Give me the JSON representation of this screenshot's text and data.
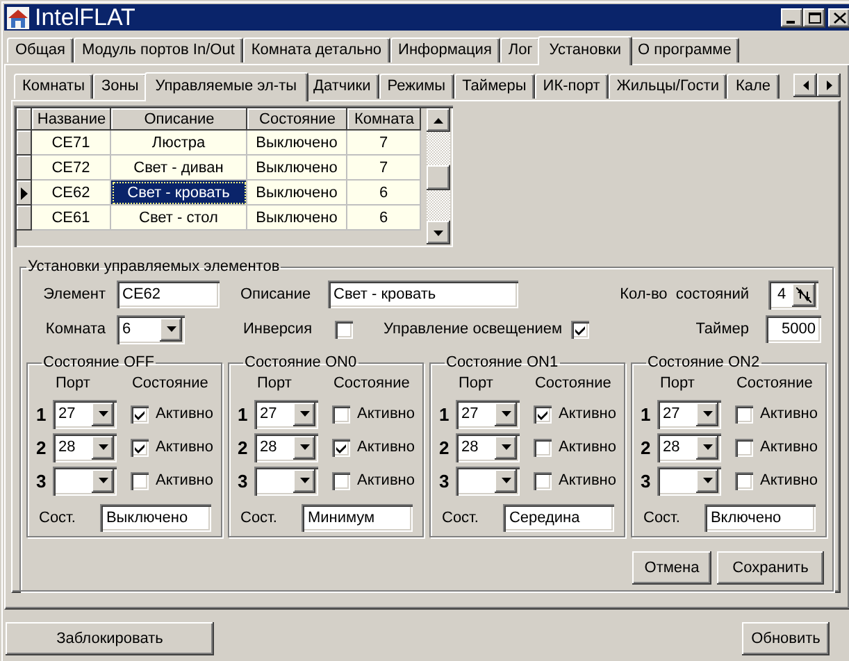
{
  "window": {
    "title": "IntelFLAT"
  },
  "tabs": [
    {
      "label": "Общая",
      "selected": false
    },
    {
      "label": "Модуль портов In/Out",
      "selected": false
    },
    {
      "label": "Комната детально",
      "selected": false
    },
    {
      "label": "Информация",
      "selected": false
    },
    {
      "label": "Лог",
      "selected": false
    },
    {
      "label": "Установки",
      "selected": true
    },
    {
      "label": "О программе",
      "selected": false
    }
  ],
  "sub_tabs": [
    {
      "label": "Комнаты",
      "selected": false
    },
    {
      "label": "Зоны",
      "selected": false
    },
    {
      "label": "Управляемые эл-ты",
      "selected": true
    },
    {
      "label": "Датчики",
      "selected": false
    },
    {
      "label": "Режимы",
      "selected": false
    },
    {
      "label": "Таймеры",
      "selected": false
    },
    {
      "label": "ИК-порт",
      "selected": false
    },
    {
      "label": "Жильцы/Гости",
      "selected": false
    },
    {
      "label": "Кале",
      "selected": false
    }
  ],
  "table": {
    "columns": [
      "Название",
      "Описание",
      "Состояние",
      "Комната"
    ],
    "rows": [
      {
        "cells": [
          "CE71",
          "Люстра",
          "Выключено",
          "7"
        ],
        "selected": false
      },
      {
        "cells": [
          "CE72",
          "Свет - диван",
          "Выключено",
          "7"
        ],
        "selected": false
      },
      {
        "cells": [
          "CE62",
          "Свет - кровать",
          "Выключено",
          "6"
        ],
        "selected": true
      },
      {
        "cells": [
          "CE61",
          "Свет - стол",
          "Выключено",
          "6"
        ],
        "selected": false
      }
    ]
  },
  "settings": {
    "title": "Установки управляемых элементов",
    "element": {
      "label": "Элемент",
      "value": "CE62"
    },
    "description": {
      "label": "Описание",
      "value": "Свет - кровать"
    },
    "state_count": {
      "label": "Кол-во  состояний",
      "value": "4"
    },
    "room": {
      "label": "Комната",
      "value": "6"
    },
    "inversion": {
      "label": "Инверсия",
      "checked": false
    },
    "lighting_control": {
      "label": "Управление освещением",
      "checked": true
    },
    "timer": {
      "label": "Таймер",
      "value": "5000"
    },
    "states": [
      {
        "title": "Состояние OFF",
        "port_header": "Порт",
        "state_header": "Состояние",
        "ports": [
          {
            "number": "1",
            "value": "27",
            "label": "Активно",
            "checked": true
          },
          {
            "number": "2",
            "value": "28",
            "label": "Активно",
            "checked": true
          },
          {
            "number": "3",
            "label": "Активно",
            "checked": false
          }
        ],
        "state_label": "Сост.",
        "state_value": "Выключено"
      },
      {
        "title": "Состояние ON0",
        "port_header": "Порт",
        "state_header": "Состояние",
        "ports": [
          {
            "number": "1",
            "value": "27",
            "label": "Активно",
            "checked": false
          },
          {
            "number": "2",
            "value": "28",
            "label": "Активно",
            "checked": true
          },
          {
            "number": "3",
            "label": "Активно",
            "checked": false
          }
        ],
        "state_label": "Сост.",
        "state_value": "Минимум"
      },
      {
        "title": "Состояние ON1",
        "port_header": "Порт",
        "state_header": "Состояние",
        "ports": [
          {
            "number": "1",
            "value": "27",
            "label": "Активно",
            "checked": true
          },
          {
            "number": "2",
            "value": "28",
            "label": "Активно",
            "checked": false
          },
          {
            "number": "3",
            "label": "Активно",
            "checked": false
          }
        ],
        "state_label": "Сост.",
        "state_value": "Середина"
      },
      {
        "title": "Состояние ON2",
        "port_header": "Порт",
        "state_header": "Состояние",
        "ports": [
          {
            "number": "1",
            "value": "27",
            "label": "Активно",
            "checked": false
          },
          {
            "number": "2",
            "value": "28",
            "label": "Активно",
            "checked": false
          },
          {
            "number": "3",
            "label": "Активно",
            "checked": false
          }
        ],
        "state_label": "Сост.",
        "state_value": "Включено"
      }
    ],
    "buttons": [
      "Отмена",
      "Сохранить"
    ]
  },
  "footer": {
    "lock_button": "Заблокировать",
    "refresh_button": "Обновить"
  }
}
